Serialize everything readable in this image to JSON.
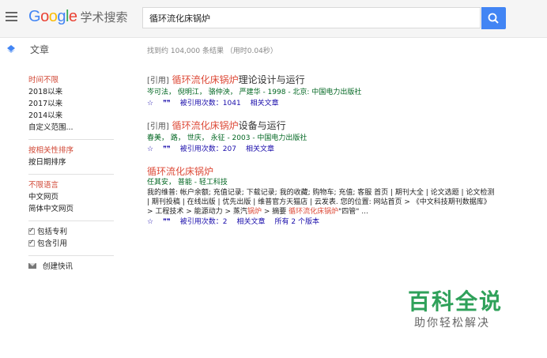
{
  "header": {
    "logo_google": "Google",
    "logo_sub": "学术搜索",
    "search_value": "循环流化床锅炉"
  },
  "section": {
    "label": "文章",
    "stats": "找到约 104,000 条结果 （用时0.04秒）"
  },
  "sidebar": {
    "time_filters": [
      "时间不限",
      "2018以来",
      "2017以来",
      "2014以来",
      "自定义范围..."
    ],
    "sort_options": [
      "按相关性排序",
      "按日期排序"
    ],
    "language_filters": [
      "不限语言",
      "中文网页",
      "简体中文网页"
    ],
    "checkboxes": [
      "包括专利",
      "包含引用"
    ],
    "create_alert": "创建快讯"
  },
  "results": [
    {
      "tag": "[引用]",
      "title_hl": "循环流化床锅炉",
      "title_rest": "理论设计与运行",
      "meta": "岑可法， 倪明江， 骆仲泱， 严建华 - 1998 - 北京: 中国电力出版社",
      "cited": "被引用次数：1041",
      "related": "相关文章"
    },
    {
      "tag": "[引用]",
      "title_hl": "循环流化床锅炉",
      "title_rest": "设备与运行",
      "meta": "春美， 路， 世庆， 永征 - 2003 - 中国电力出版社",
      "cited": "被引用次数：207",
      "related": "相关文章"
    },
    {
      "tag": "",
      "title_hl": "循环流化床锅炉",
      "title_rest": "",
      "meta": "任其安， 普能 - 轻工科技",
      "snippet_a": "我的维普: 帐户余额; 充值记录; 下载记录; 我的收藏; 购物车; 充值; 客服 首页 | 期刊大全 | 论文选题 | 论文检测 | 期刊投稿 | 在线出版 | 优先出版 | 维普官方天猫店 | 云发表. 您的位置: 网站首页 > 《中文科技期刊数据库》 > 工程技术 > 能源动力 > 蒸汽",
      "snippet_hl1": "锅炉",
      "snippet_b": " > 摘要 ",
      "snippet_hl2": "循环流化床锅炉",
      "snippet_c": "\"四管\" ...",
      "cited": "被引用次数：2",
      "related": "相关文章",
      "versions": "所有 2 个版本"
    }
  ],
  "watermark": {
    "big": "百科全说",
    "small": "助你轻松解决"
  },
  "colors": {
    "accent_blue": "#4285f4",
    "highlight_red": "#dd4b39",
    "meta_green": "#006621",
    "link_blue": "#1a0dab"
  }
}
